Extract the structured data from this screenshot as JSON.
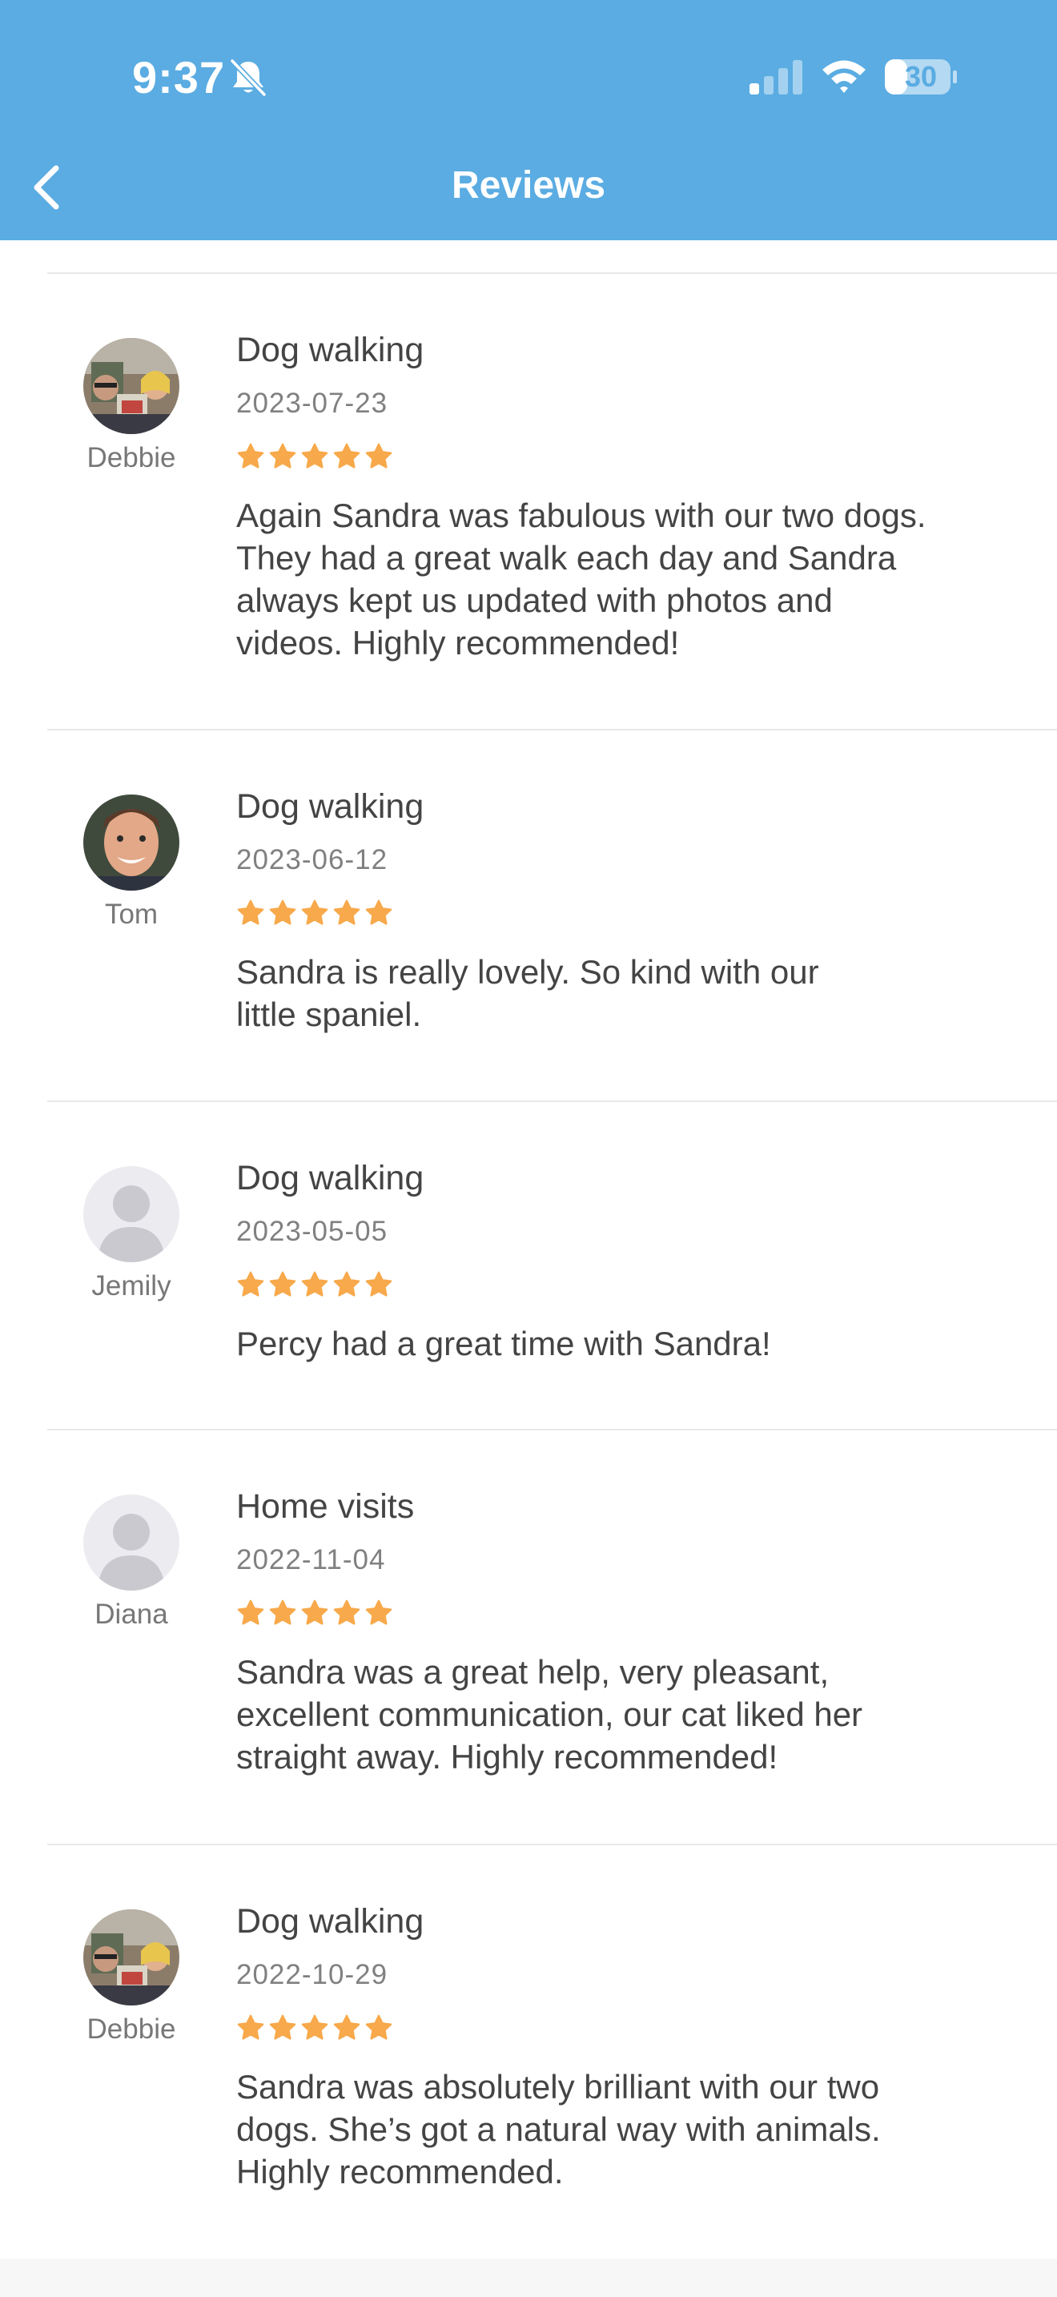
{
  "status_bar": {
    "time": "9:37",
    "battery": "30"
  },
  "nav": {
    "title": "Reviews"
  },
  "reviews": [
    {
      "reviewer": "Debbie",
      "avatar": "photo",
      "service": "Dog walking",
      "date": "2023-07-23",
      "rating": 5,
      "comment": "Again Sandra was fabulous with our two dogs.\nThey had a great walk each day and Sandra\nalways kept us updated with photos and\nvideos. Highly recommended!"
    },
    {
      "reviewer": "Tom",
      "avatar": "photo",
      "service": "Dog walking",
      "date": "2023-06-12",
      "rating": 5,
      "comment": "Sandra is really lovely. So kind with our\nlittle spaniel."
    },
    {
      "reviewer": "Jemily",
      "avatar": "placeholder",
      "service": "Dog walking",
      "date": "2023-05-05",
      "rating": 5,
      "comment": "Percy had a great time with Sandra!"
    },
    {
      "reviewer": "Diana",
      "avatar": "placeholder",
      "service": "Home visits",
      "date": "2022-11-04",
      "rating": 5,
      "comment": "Sandra was a great help, very pleasant,\nexcellent communication, our cat liked her\nstraight away. Highly recommended!"
    },
    {
      "reviewer": "Debbie",
      "avatar": "photo",
      "service": "Dog walking",
      "date": "2022-10-29",
      "rating": 5,
      "comment": "Sandra was absolutely brilliant with our two\ndogs. She’s got a natural way with animals.\nHighly recommended."
    }
  ],
  "colors": {
    "header": "#5aace2",
    "star": "#f7a94b",
    "divider": "#e8e8e8",
    "placeholder_avatar_bg": "#ececf0",
    "placeholder_avatar_fg": "#c9c9cf"
  }
}
